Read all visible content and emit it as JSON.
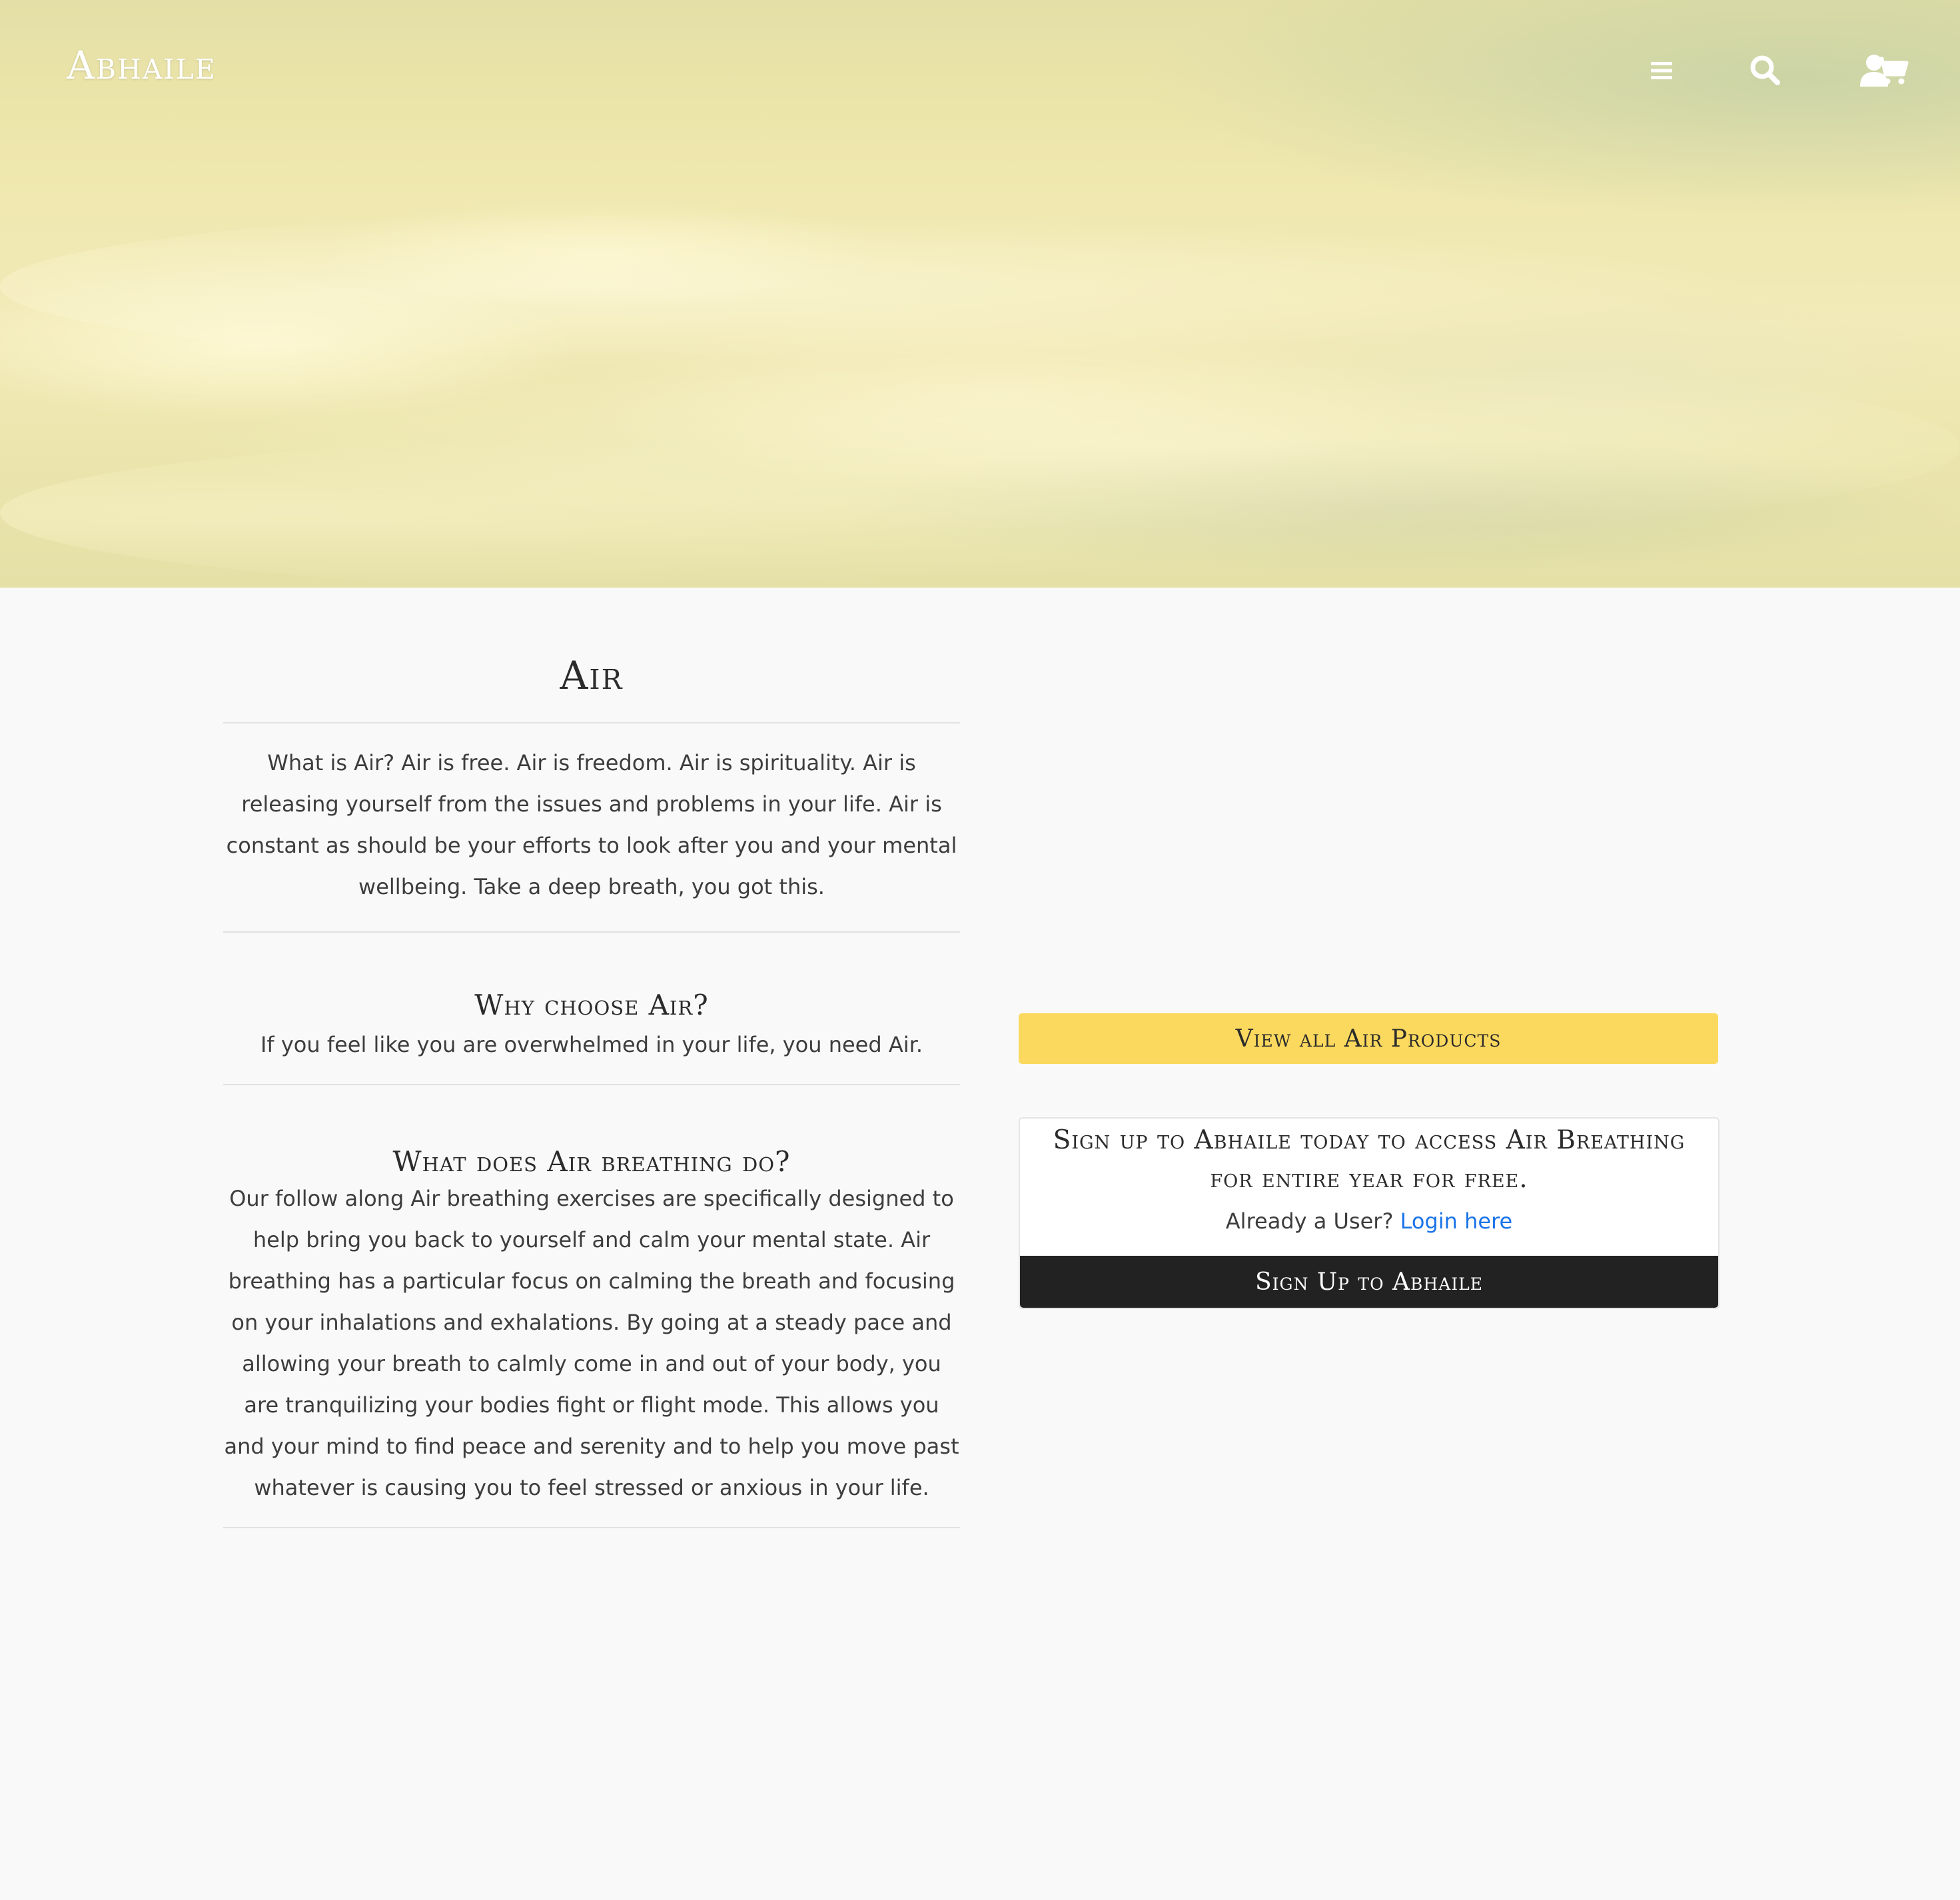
{
  "header": {
    "brand": "Abhaile",
    "icons": [
      "menu-icon",
      "search-icon",
      "user-icon",
      "cart-icon"
    ]
  },
  "hero": {
    "image": "clouds-from-above",
    "tint": "#f2eab8"
  },
  "main": {
    "title": "Air",
    "intro": "What is Air? Air is free. Air is freedom. Air is spirituality. Air is releasing yourself from the issues and problems in your life. Air is constant as should be your efforts to look after you and your mental wellbeing. Take a deep breath, you got this.",
    "sections": [
      {
        "heading": "Why choose Air?",
        "body": "If you feel like you are overwhelmed in your life, you need Air."
      },
      {
        "heading": "What does Air breathing do?",
        "body": "Our follow along Air breathing exercises are specifically designed to help bring you back to yourself and calm your mental state. Air breathing has a particular focus on calming the breath and focusing on your inhalations and exhalations. By going at a steady pace and allowing your breath to calmly come in and out of your body, you are tranquilizing your bodies fight or flight mode. This allows you and your mind to find peace and serenity and to help you move past whatever is causing you to feel stressed or anxious in your life."
      }
    ]
  },
  "sidebar": {
    "products_button": "View all Air Products",
    "signup_card": {
      "title": "Sign up to Abhaile today to access Air Breathing for entire year for free.",
      "login_prompt": "Already a User?",
      "login_link": "Login here",
      "signup_button": "Sign Up to Abhaile"
    }
  },
  "colors": {
    "accent_yellow": "#fbd95e",
    "dark_button": "#222222",
    "link_blue": "#1a73e8",
    "page_bg": "#f9f9f9"
  }
}
